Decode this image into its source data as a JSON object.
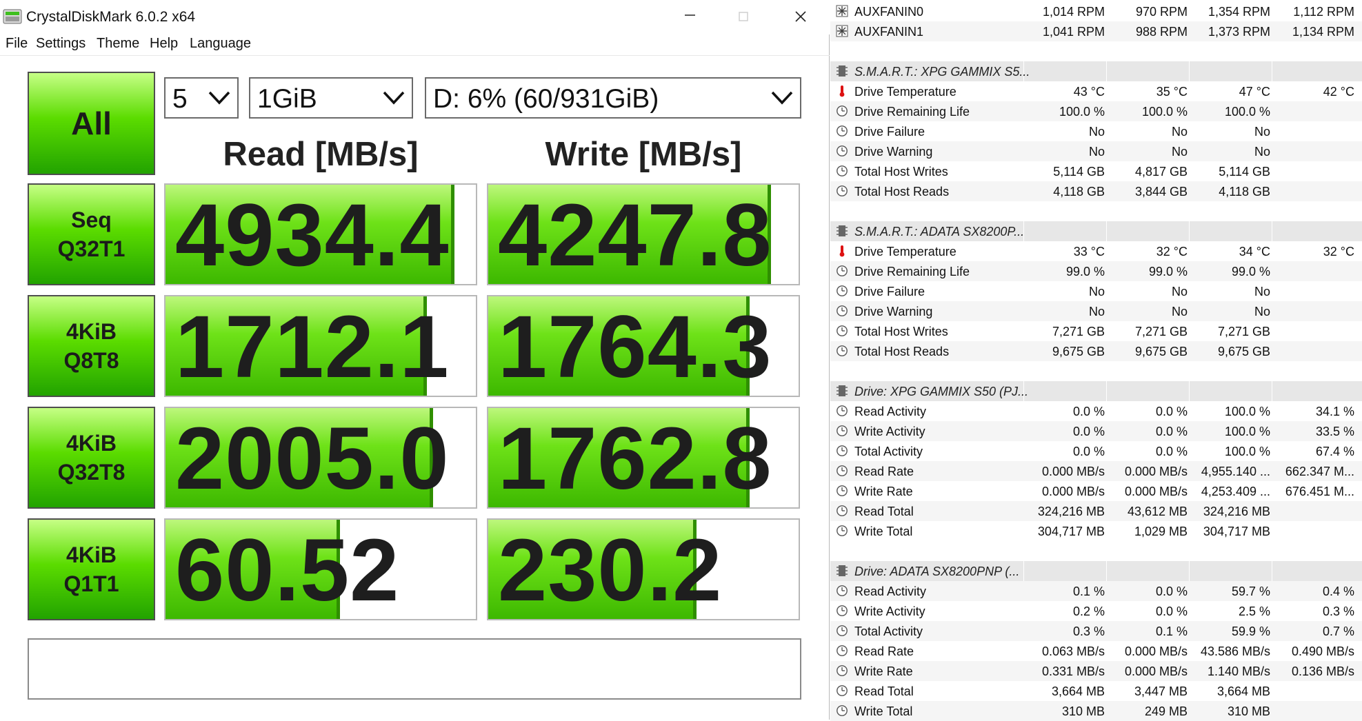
{
  "window": {
    "title": "CrystalDiskMark 6.0.2 x64"
  },
  "menu": [
    "File",
    "Settings",
    "Theme",
    "Help",
    "Language"
  ],
  "controls": {
    "all_label": "All",
    "count": "5",
    "size": "1GiB",
    "drive": "D: 6% (60/931GiB)"
  },
  "headers": {
    "read": "Read [MB/s]",
    "write": "Write [MB/s]"
  },
  "tests": [
    {
      "line1": "Seq",
      "line2": "Q32T1",
      "read": "4934.4",
      "write": "4247.8",
      "read_fill_pct": 92,
      "write_fill_pct": 90
    },
    {
      "line1": "4KiB",
      "line2": "Q8T8",
      "read": "1712.1",
      "write": "1764.3",
      "read_fill_pct": 83,
      "write_fill_pct": 83
    },
    {
      "line1": "4KiB",
      "line2": "Q32T8",
      "read": "2005.0",
      "write": "1762.8",
      "read_fill_pct": 85,
      "write_fill_pct": 83
    },
    {
      "line1": "4KiB",
      "line2": "Q1T1",
      "read": "60.52",
      "write": "230.2",
      "read_fill_pct": 55,
      "write_fill_pct": 66
    }
  ],
  "colors": {
    "accent_green": "#5bdc00",
    "panel_header_gray": "#e7e7e7"
  },
  "sensors": [
    {
      "type": "row",
      "icon": "fan-icon",
      "name": "AUXFANIN0",
      "v": [
        "1,014 RPM",
        "970 RPM",
        "1,354 RPM",
        "1,112 RPM"
      ]
    },
    {
      "type": "row",
      "icon": "fan-icon",
      "name": "AUXFANIN1",
      "v": [
        "1,041 RPM",
        "988 RPM",
        "1,373 RPM",
        "1,134 RPM"
      ]
    },
    {
      "type": "blank"
    },
    {
      "type": "group",
      "icon": "drive-chip-icon",
      "name": "S.M.A.R.T.: XPG GAMMIX S5..."
    },
    {
      "type": "row",
      "icon": "thermometer-icon",
      "name": "Drive Temperature",
      "v": [
        "43 °C",
        "35 °C",
        "47 °C",
        "42 °C"
      ]
    },
    {
      "type": "row",
      "icon": "clock-gauge-icon",
      "name": "Drive Remaining Life",
      "v": [
        "100.0 %",
        "100.0 %",
        "100.0 %",
        ""
      ]
    },
    {
      "type": "row",
      "icon": "clock-gauge-icon",
      "name": "Drive Failure",
      "v": [
        "No",
        "No",
        "No",
        ""
      ]
    },
    {
      "type": "row",
      "icon": "clock-gauge-icon",
      "name": "Drive Warning",
      "v": [
        "No",
        "No",
        "No",
        ""
      ]
    },
    {
      "type": "row",
      "icon": "clock-gauge-icon",
      "name": "Total Host Writes",
      "v": [
        "5,114 GB",
        "4,817 GB",
        "5,114 GB",
        ""
      ]
    },
    {
      "type": "row",
      "icon": "clock-gauge-icon",
      "name": "Total Host Reads",
      "v": [
        "4,118 GB",
        "3,844 GB",
        "4,118 GB",
        ""
      ]
    },
    {
      "type": "blank"
    },
    {
      "type": "group",
      "icon": "drive-chip-icon",
      "name": "S.M.A.R.T.: ADATA SX8200P..."
    },
    {
      "type": "row",
      "icon": "thermometer-icon",
      "name": "Drive Temperature",
      "v": [
        "33 °C",
        "32 °C",
        "34 °C",
        "32 °C"
      ]
    },
    {
      "type": "row",
      "icon": "clock-gauge-icon",
      "name": "Drive Remaining Life",
      "v": [
        "99.0 %",
        "99.0 %",
        "99.0 %",
        ""
      ]
    },
    {
      "type": "row",
      "icon": "clock-gauge-icon",
      "name": "Drive Failure",
      "v": [
        "No",
        "No",
        "No",
        ""
      ]
    },
    {
      "type": "row",
      "icon": "clock-gauge-icon",
      "name": "Drive Warning",
      "v": [
        "No",
        "No",
        "No",
        ""
      ]
    },
    {
      "type": "row",
      "icon": "clock-gauge-icon",
      "name": "Total Host Writes",
      "v": [
        "7,271 GB",
        "7,271 GB",
        "7,271 GB",
        ""
      ]
    },
    {
      "type": "row",
      "icon": "clock-gauge-icon",
      "name": "Total Host Reads",
      "v": [
        "9,675 GB",
        "9,675 GB",
        "9,675 GB",
        ""
      ]
    },
    {
      "type": "blank"
    },
    {
      "type": "group",
      "icon": "drive-chip-icon",
      "name": "Drive: XPG GAMMIX S50 (PJ..."
    },
    {
      "type": "row",
      "icon": "clock-gauge-icon",
      "name": "Read Activity",
      "v": [
        "0.0 %",
        "0.0 %",
        "100.0 %",
        "34.1 %"
      ]
    },
    {
      "type": "row",
      "icon": "clock-gauge-icon",
      "name": "Write Activity",
      "v": [
        "0.0 %",
        "0.0 %",
        "100.0 %",
        "33.5 %"
      ]
    },
    {
      "type": "row",
      "icon": "clock-gauge-icon",
      "name": "Total Activity",
      "v": [
        "0.0 %",
        "0.0 %",
        "100.0 %",
        "67.4 %"
      ]
    },
    {
      "type": "row",
      "icon": "clock-gauge-icon",
      "name": "Read Rate",
      "v": [
        "0.000 MB/s",
        "0.000 MB/s",
        "4,955.140 ...",
        "662.347 M..."
      ]
    },
    {
      "type": "row",
      "icon": "clock-gauge-icon",
      "name": "Write Rate",
      "v": [
        "0.000 MB/s",
        "0.000 MB/s",
        "4,253.409 ...",
        "676.451 M..."
      ]
    },
    {
      "type": "row",
      "icon": "clock-gauge-icon",
      "name": "Read Total",
      "v": [
        "324,216 MB",
        "43,612 MB",
        "324,216 MB",
        ""
      ]
    },
    {
      "type": "row",
      "icon": "clock-gauge-icon",
      "name": "Write Total",
      "v": [
        "304,717 MB",
        "1,029 MB",
        "304,717 MB",
        ""
      ]
    },
    {
      "type": "blank"
    },
    {
      "type": "group",
      "icon": "drive-chip-icon",
      "name": "Drive: ADATA SX8200PNP (..."
    },
    {
      "type": "row",
      "icon": "clock-gauge-icon",
      "name": "Read Activity",
      "v": [
        "0.1 %",
        "0.0 %",
        "59.7 %",
        "0.4 %"
      ]
    },
    {
      "type": "row",
      "icon": "clock-gauge-icon",
      "name": "Write Activity",
      "v": [
        "0.2 %",
        "0.0 %",
        "2.5 %",
        "0.3 %"
      ]
    },
    {
      "type": "row",
      "icon": "clock-gauge-icon",
      "name": "Total Activity",
      "v": [
        "0.3 %",
        "0.1 %",
        "59.9 %",
        "0.7 %"
      ]
    },
    {
      "type": "row",
      "icon": "clock-gauge-icon",
      "name": "Read Rate",
      "v": [
        "0.063 MB/s",
        "0.000 MB/s",
        "43.586 MB/s",
        "0.490 MB/s"
      ]
    },
    {
      "type": "row",
      "icon": "clock-gauge-icon",
      "name": "Write Rate",
      "v": [
        "0.331 MB/s",
        "0.000 MB/s",
        "1.140 MB/s",
        "0.136 MB/s"
      ]
    },
    {
      "type": "row",
      "icon": "clock-gauge-icon",
      "name": "Read Total",
      "v": [
        "3,664 MB",
        "3,447 MB",
        "3,664 MB",
        ""
      ]
    },
    {
      "type": "row",
      "icon": "clock-gauge-icon",
      "name": "Write Total",
      "v": [
        "310 MB",
        "249 MB",
        "310 MB",
        ""
      ]
    }
  ]
}
